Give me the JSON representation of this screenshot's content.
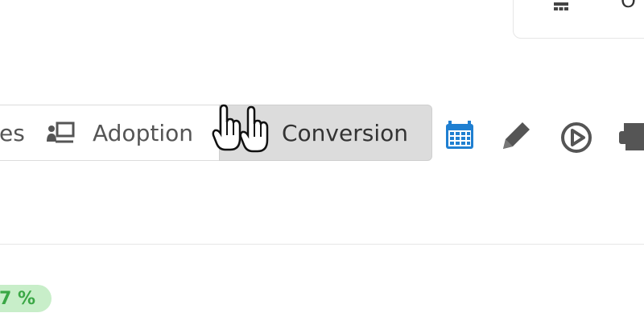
{
  "top_card": {
    "partial_text": "O",
    "icon": "grid-icon"
  },
  "tabs": [
    {
      "label": "es",
      "icon": null
    },
    {
      "label": "Adoption",
      "icon": "presentation-icon"
    },
    {
      "label": "Conversion",
      "icon": null,
      "selected": true
    }
  ],
  "toolbar": {
    "icons": [
      "calendar-icon",
      "pencil-icon",
      "play-circle-icon",
      "print-icon"
    ],
    "calendar_color": "#1f7fd1",
    "icon_color": "#555555"
  },
  "badge": {
    "text": "7 %",
    "bg": "#c8eec9",
    "color": "#3aa745"
  },
  "cursors": [
    "hand-cursor-icon",
    "hand-cursor-icon"
  ]
}
